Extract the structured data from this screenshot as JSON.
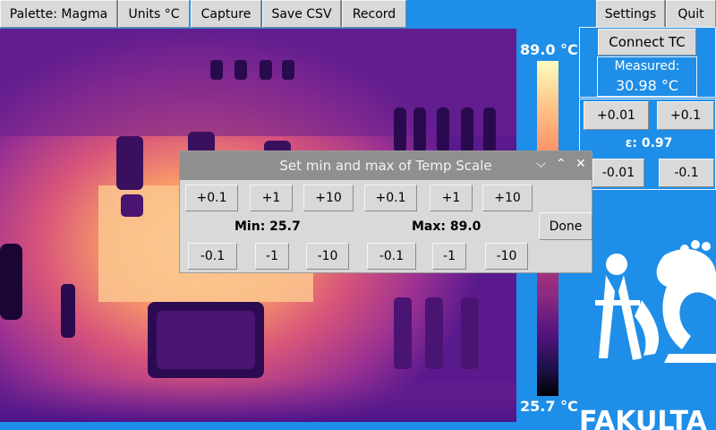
{
  "toolbar": {
    "palette": "Palette: Magma",
    "units": "Units °C",
    "capture": "Capture",
    "save_csv": "Save CSV",
    "record": "Record",
    "settings": "Settings",
    "quit": "Quit"
  },
  "scale": {
    "max": "89.0 °C",
    "min": "25.7 °C"
  },
  "side": {
    "connect": "Connect TC",
    "measured_label": "Measured:",
    "measured_value": "30.98 °C",
    "plus_001": "+0.01",
    "plus_01": "+0.1",
    "emissivity": "ε: 0.97",
    "minus_001": "-0.01",
    "minus_01": "-0.1",
    "logo_text": "FAKULTA"
  },
  "dialog": {
    "title": "Set min and max of Temp Scale",
    "min_plus": [
      "+0.1",
      "+1",
      "+10"
    ],
    "max_plus": [
      "+0.1",
      "+1",
      "+10"
    ],
    "min_label": "Min: 25.7",
    "max_label": "Max: 89.0",
    "done": "Done",
    "min_minus": [
      "-0.1",
      "-1",
      "-10"
    ],
    "max_minus": [
      "-0.1",
      "-1",
      "-10"
    ]
  },
  "colors": {
    "background": "#1e8ee8",
    "button": "#d9d9d9",
    "titlebar": "#8f8f8f"
  }
}
